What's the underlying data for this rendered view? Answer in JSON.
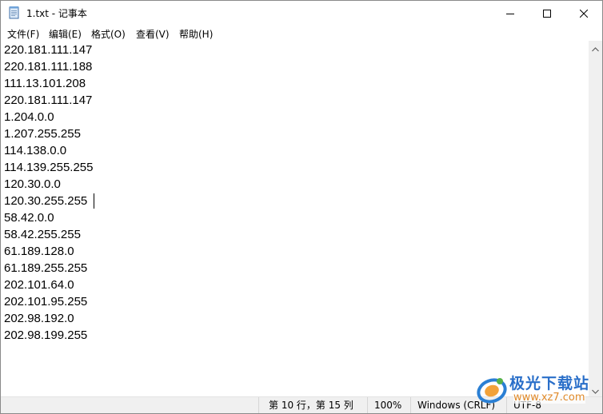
{
  "window": {
    "title": "1.txt - 记事本"
  },
  "menu": {
    "file": "文件(F)",
    "edit": "编辑(E)",
    "format": "格式(O)",
    "view": "查看(V)",
    "help": "帮助(H)"
  },
  "editor": {
    "lines": [
      "220.181.111.147",
      "220.181.111.188",
      "111.13.101.208",
      "220.181.111.147",
      "1.204.0.0",
      "1.207.255.255",
      "114.138.0.0",
      "114.139.255.255",
      "120.30.0.0",
      "120.30.255.255",
      "58.42.0.0",
      "58.42.255.255",
      "61.189.128.0",
      "61.189.255.255",
      "202.101.64.0",
      "202.101.95.255",
      "202.98.192.0",
      "202.98.199.255"
    ]
  },
  "statusbar": {
    "position": "第 10 行，第 15 列",
    "zoom": "100%",
    "line_ending": "Windows (CRLF)",
    "encoding": "UTF-8"
  },
  "watermark": {
    "name": "极光下载站",
    "url": "www.xz7.com"
  },
  "icons": {
    "app": "notepad-icon",
    "minimize": "minimize-icon",
    "maximize": "maximize-icon",
    "close": "close-icon",
    "scroll_up": "chevron-up-icon",
    "scroll_down": "chevron-down-icon"
  }
}
